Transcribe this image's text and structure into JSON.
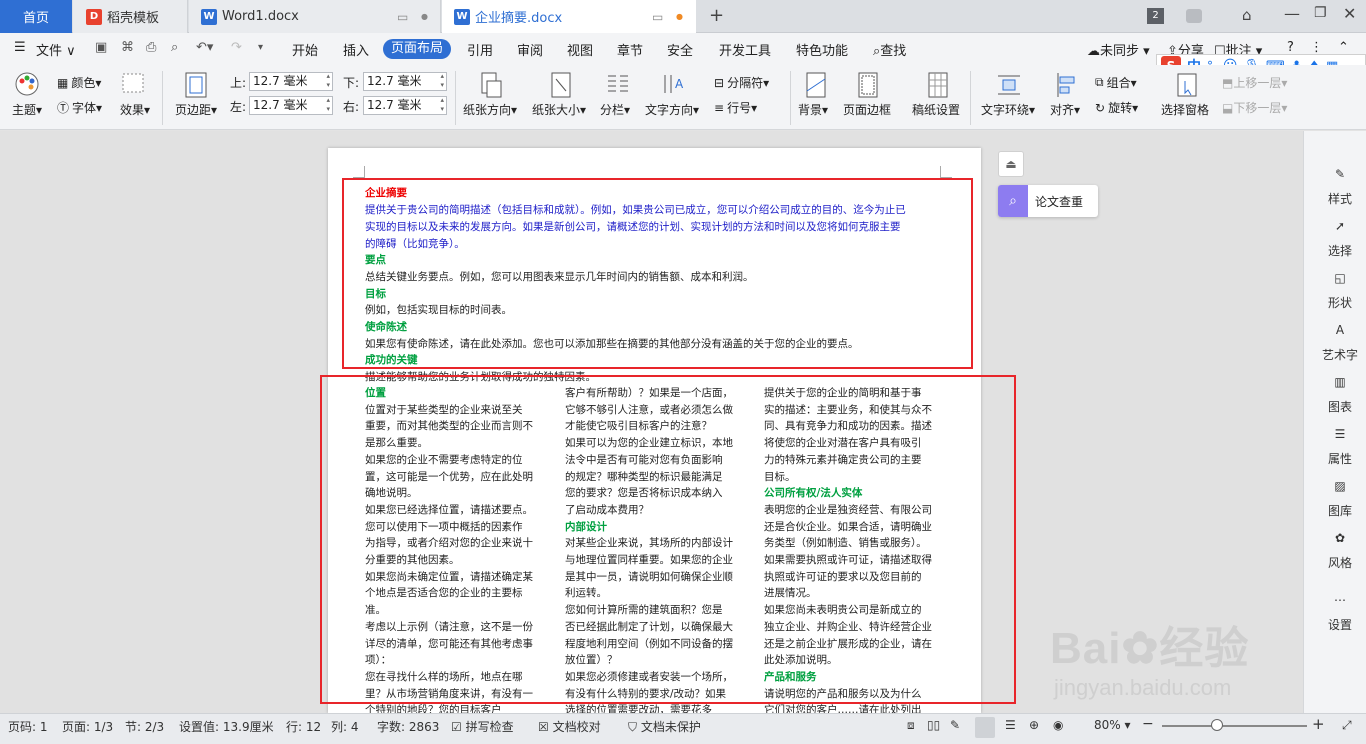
{
  "tabs": {
    "home": "首页",
    "daoke": "稻壳模板",
    "word1": "Word1.docx",
    "current": "企业摘要.docx",
    "badge": "2"
  },
  "menu": {
    "file": "文件",
    "items": [
      "开始",
      "插入",
      "页面布局",
      "引用",
      "审阅",
      "视图",
      "章节",
      "安全",
      "开发工具",
      "特色功能"
    ],
    "search": "查找",
    "sync": "未同步",
    "share": "分享",
    "comment": "批注"
  },
  "ime": {
    "lang": "中",
    "punct": "°,"
  },
  "ribbon": {
    "theme": "主题",
    "color": "颜色",
    "font": "字体",
    "effect": "效果",
    "margin": "页边距",
    "top_label": "上:",
    "top_val": "12.7 毫米",
    "left_label": "左:",
    "left_val": "12.7 毫米",
    "bottom_label": "下:",
    "bottom_val": "12.7 毫米",
    "right_label": "右:",
    "right_val": "12.7 毫米",
    "orientation": "纸张方向",
    "size": "纸张大小",
    "columns": "分栏",
    "text_dir": "文字方向",
    "separator": "分隔符",
    "line_no": "行号",
    "background": "背景",
    "page_border": "页面边框",
    "grid_paper": "稿纸设置",
    "wrap": "文字环绕",
    "align": "对齐",
    "group": "组合",
    "rotate": "旋转",
    "selection_pane": "选择窗格",
    "up": "上移一层",
    "down": "下移一层"
  },
  "float": {
    "paper_check": "论文查重"
  },
  "doc": {
    "title": "企业摘要",
    "intro": [
      "提供关于贵公司的简明描述（包括目标和成就）。例如，如果贵公司已成立，您可以介绍公司成立的目的、迄今为止已",
      "实现的目标以及未来的发展方向。如果是新创公司，请概述您的计划、实现计划的方法和时间以及您将如何克服主要",
      "的障碍（比如竞争）。"
    ],
    "h_key": "要点",
    "p_key": "总结关键业务要点。例如，您可以用图表来显示几年时间内的销售额、成本和利润。",
    "h_goal": "目标",
    "p_goal": "例如，包括实现目标的时间表。",
    "h_mission": "使命陈述",
    "p_mission": "如果您有使命陈述，请在此处添加。您也可以添加那些在摘要的其他部分没有涵盖的关于您的企业的要点。",
    "h_success": "成功的关键",
    "p_success": "描述能够帮助您的业务计划取得成功的独特因素。",
    "col1": [
      {
        "t": "h",
        "v": "位置"
      },
      {
        "t": "p",
        "v": "位置对于某些类型的企业来说至关"
      },
      {
        "t": "p",
        "v": "重要，而对其他类型的企业而言则不"
      },
      {
        "t": "p",
        "v": "是那么重要。"
      },
      {
        "t": "p",
        "v": "如果您的企业不需要考虑特定的位"
      },
      {
        "t": "p",
        "v": "置，这可能是一个优势，应在此处明"
      },
      {
        "t": "p",
        "v": "确地说明。"
      },
      {
        "t": "p",
        "v": "如果您已经选择位置，请描述要点。"
      },
      {
        "t": "p",
        "v": "您可以使用下一项中概括的因素作"
      },
      {
        "t": "p",
        "v": "为指导，或者介绍对您的企业来说十"
      },
      {
        "t": "p",
        "v": "分重要的其他因素。"
      },
      {
        "t": "p",
        "v": "如果您尚未确定位置，请描述确定某"
      },
      {
        "t": "p",
        "v": "个地点是否适合您的企业的主要标"
      },
      {
        "t": "p",
        "v": "准。"
      },
      {
        "t": "p",
        "v": "考虑以上示例（请注意，这不是一份"
      },
      {
        "t": "p",
        "v": "详尽的清单，您可能还有其他考虑事"
      },
      {
        "t": "p",
        "v": "项）："
      },
      {
        "t": "p",
        "v": "您在寻找什么样的场所，地点在哪"
      },
      {
        "t": "p",
        "v": "里？从市场营销角度来讲，有没有一"
      },
      {
        "t": "p",
        "v": "个特别的地段？您的目标客户"
      }
    ],
    "col2": [
      {
        "t": "p",
        "v": "客户有所帮助）？如果是一个店面，"
      },
      {
        "t": "p",
        "v": "它够不够引人注意，或者必须怎么做"
      },
      {
        "t": "p",
        "v": "才能使它吸引目标客户的注意？"
      },
      {
        "t": "p",
        "v": "如果可以为您的企业建立标识，本地"
      },
      {
        "t": "p",
        "v": "法令中是否有可能对您有负面影响"
      },
      {
        "t": "p",
        "v": "的规定？哪种类型的标识最能满足"
      },
      {
        "t": "p",
        "v": "您的要求？您是否将标识成本纳入"
      },
      {
        "t": "p",
        "v": "了启动成本费用？"
      },
      {
        "t": "h",
        "v": "内部设计"
      },
      {
        "t": "p",
        "v": "对某些企业来说，其场所的内部设计"
      },
      {
        "t": "p",
        "v": "与地理位置同样重要。如果您的企业"
      },
      {
        "t": "p",
        "v": "是其中一员，请说明如何确保企业顺"
      },
      {
        "t": "p",
        "v": "利运转。"
      },
      {
        "t": "p",
        "v": "您如何计算所需的建筑面积？您是"
      },
      {
        "t": "p",
        "v": "否已经据此制定了计划，以确保最大"
      },
      {
        "t": "p",
        "v": "程度地利用空间（例如不同设备的摆"
      },
      {
        "t": "p",
        "v": "放位置）？"
      },
      {
        "t": "p",
        "v": "如果您必须修建或者安装一个场所，"
      },
      {
        "t": "p",
        "v": "有没有什么特别的要求/改动？如果"
      },
      {
        "t": "p",
        "v": "选择的位置需要改动，需要花多"
      }
    ],
    "col3": [
      {
        "t": "p",
        "v": "提供关于您的企业的简明和基于事"
      },
      {
        "t": "p",
        "v": "实的描述：主要业务，和使其与众不"
      },
      {
        "t": "p",
        "v": "同、具有竞争力和成功的因素。描述"
      },
      {
        "t": "p",
        "v": "将使您的企业对潜在客户具有吸引"
      },
      {
        "t": "p",
        "v": "力的特殊元素并确定贵公司的主要"
      },
      {
        "t": "p",
        "v": "目标。"
      },
      {
        "t": "h",
        "v": "公司所有权/法人实体"
      },
      {
        "t": "p",
        "v": "表明您的企业是独资经营、有限公司"
      },
      {
        "t": "p",
        "v": "还是合伙企业。如果合适，请明确业"
      },
      {
        "t": "p",
        "v": "务类型（例如制造、销售或服务）。"
      },
      {
        "t": "p",
        "v": "如果需要执照或许可证，请描述取得"
      },
      {
        "t": "p",
        "v": "执照或许可证的要求以及您目前的"
      },
      {
        "t": "p",
        "v": "进展情况。"
      },
      {
        "t": "p",
        "v": "如果您尚未表明贵公司是新成立的"
      },
      {
        "t": "p",
        "v": "独立企业、并购企业、特许经营企业"
      },
      {
        "t": "p",
        "v": "还是之前企业扩展形成的企业，请在"
      },
      {
        "t": "p",
        "v": "此处添加说明。"
      },
      {
        "t": "h",
        "v": "产品和服务"
      },
      {
        "t": "p",
        "v": "请说明您的产品和服务以及为什么"
      },
      {
        "t": "p",
        "v": "它们对您的客户……请在此处列出"
      }
    ]
  },
  "side": {
    "style": "样式",
    "select": "选择",
    "shape": "形状",
    "art": "艺术字",
    "chart": "图表",
    "prop": "属性",
    "gallery": "图库",
    "style2": "风格",
    "settings": "设置"
  },
  "status": {
    "page_code": "页码: 1",
    "page": "页面: 1/3",
    "section": "节: 2/3",
    "setting": "设置值: 13.9厘米",
    "row": "行: 12",
    "col": "列: 4",
    "words": "字数: 2863",
    "spell": "拼写检查",
    "proof": "文档校对",
    "protect": "文档未保护",
    "zoom": "80%"
  },
  "watermark": {
    "brand": "Bai",
    "brand2": "经验",
    "url": "jingyan.baidu.com"
  },
  "colors": {
    "accent": "#2f6fd3",
    "heading_green": "#00a040",
    "heading_red": "#ee0000",
    "intro_blue": "#2020c8",
    "annotation": "#e8252a"
  }
}
